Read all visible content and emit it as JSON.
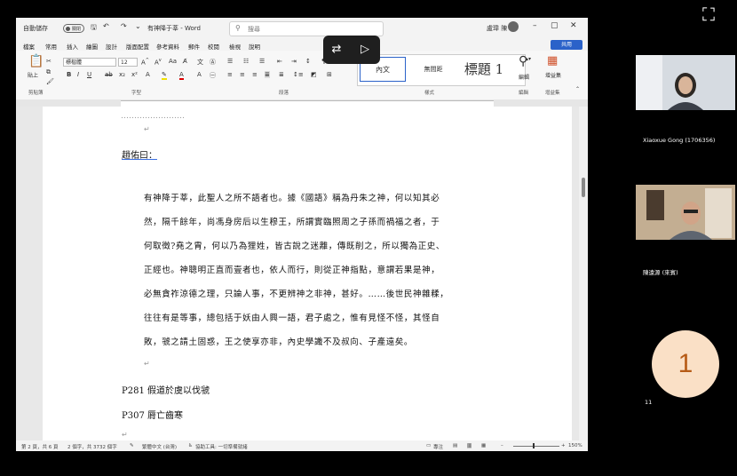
{
  "word": {
    "titlebar": {
      "autosave_label": "自動儲存",
      "autosave_state": "關閉",
      "doc_title": "有神降于莘 - Word",
      "search_placeholder": "搜尋",
      "user_name": "盧瑋 陳"
    },
    "menu": [
      "檔案",
      "常用",
      "插入",
      "繪圖",
      "設計",
      "版面配置",
      "參考資料",
      "郵件",
      "校閱",
      "檢視",
      "說明"
    ],
    "share_label": "共用",
    "ribbon": {
      "paste_label": "貼上",
      "font_name": "標楷體",
      "font_size": "12",
      "groups": [
        "剪貼簿",
        "字型",
        "段落",
        "樣式",
        "編輯",
        "增益集"
      ],
      "styles": [
        "內文",
        "無間距",
        "標題 1"
      ],
      "edit_label": "編輯",
      "addins_label": "增益集"
    },
    "document": {
      "heading": "趙佑曰：",
      "lines": [
        "有神降于莘，此聖人之所不語者也。據《國語》稱為丹朱之神，何以知其必",
        "然，隔千餘年，尚馮身房后以生穆王，所謂實臨照周之子孫而禍福之者，于",
        "何取徵?堯之胄，何以乃為狸姓，皆古說之迷離，傳既削之，所以獨為正史、",
        "正經也。神聰明正直而壹者也，依人而行，則從正神指點，意謂若果是神，",
        "必無貪祚涼德之理，只論人事，不更辨神之非神，甚好。……後世民神雜糅，",
        "往往有是等事，總包括于妖由人興一語，君子處之，惟有見怪不怪，其怪自",
        "敗，虢之請土固惑，王之使享亦非，內史學識不及叔向、子產遠矣。"
      ],
      "ref1": "P281 假道於虞以伐虢",
      "ref2": "P307 脣亡齒寒"
    },
    "statusbar": {
      "page_info": "第 2 頁，共 6 頁",
      "word_count": "2 個字，共 3732 個字",
      "language": "繁體中文 (台灣)",
      "accessibility": "協助工具: 一切準備就緒",
      "focus": "專注",
      "zoom": "150%"
    }
  },
  "meeting": {
    "participants": [
      {
        "name": "Xiaoxue Gong (1706356)"
      },
      {
        "name": "陳遠源 (來賓)"
      }
    ],
    "avatar_count": "1",
    "small_count": "11"
  }
}
